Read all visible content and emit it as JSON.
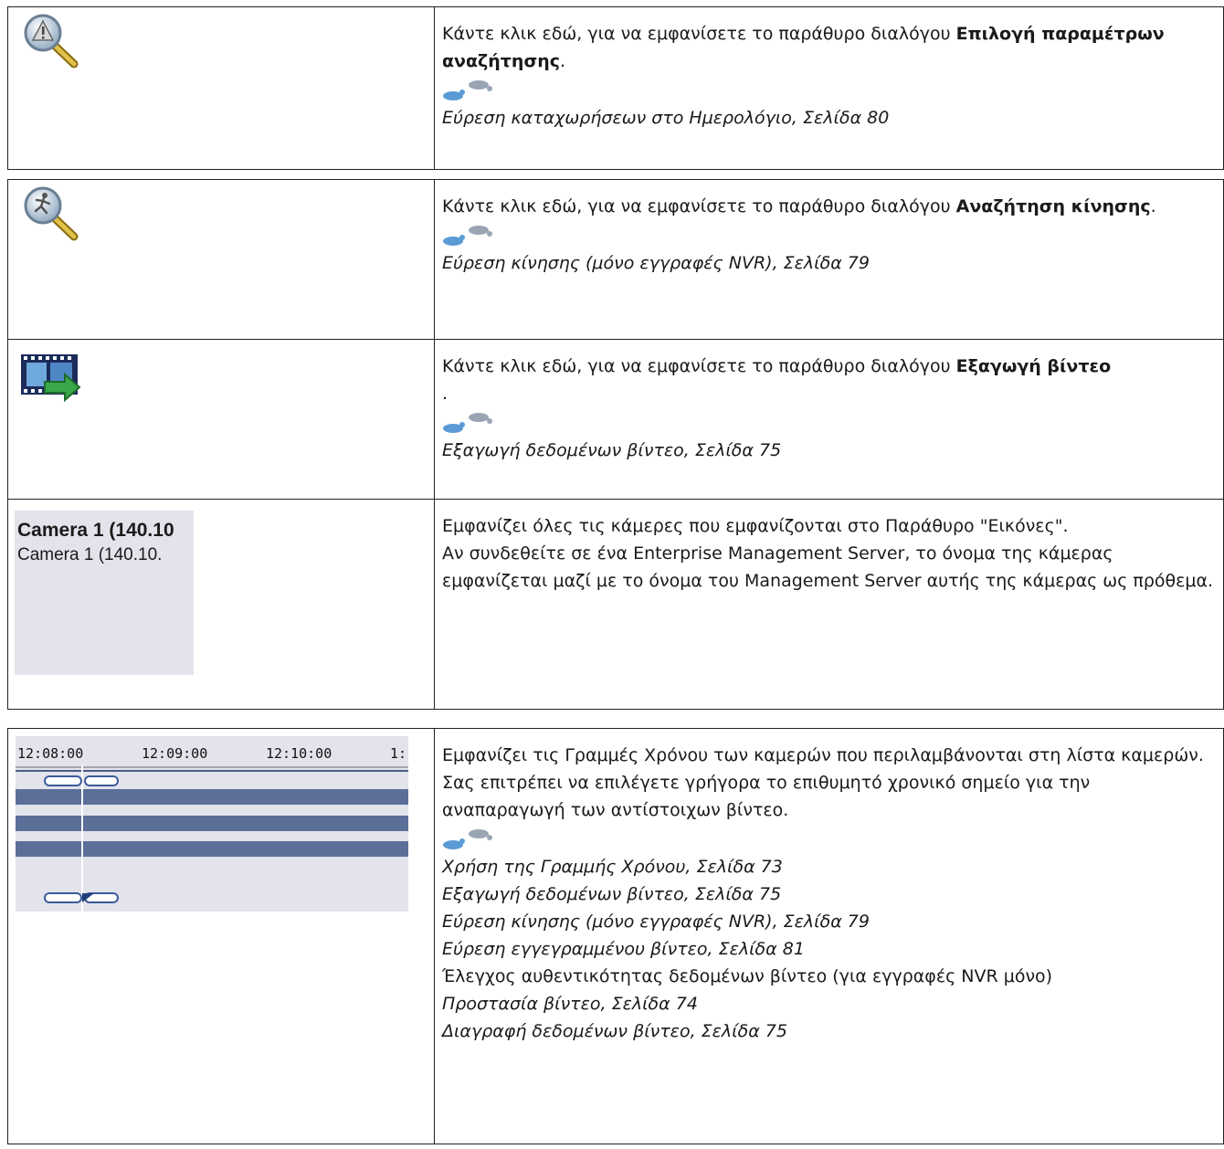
{
  "rows": [
    {
      "icon": "alarm-search-icon",
      "text_before": "Κάντε κλικ εδώ, για να εμφανίσετε το παράθυρο διαλόγου ",
      "bold": "Επιλογή παραμέτρων αναζήτησης",
      "text_after": ".",
      "links": [
        "Εύρεση καταχωρήσεων στο Ημερολόγιο, Σελίδα 80"
      ]
    },
    {
      "icon": "motion-search-icon",
      "text_before": "Κάντε κλικ εδώ, για να εμφανίσετε το παράθυρο διαλόγου ",
      "bold": "Αναζήτηση κίνησης",
      "text_after": ".",
      "links": [
        "Εύρεση κίνησης (μόνο εγγραφές NVR), Σελίδα 79"
      ]
    },
    {
      "icon": "video-export-icon",
      "text_before": "Κάντε κλικ εδώ, για να εμφανίσετε το παράθυρο διαλόγου ",
      "bold": "Εξαγωγή βίντεο",
      "text_after": ".",
      "links": [
        "Εξαγωγή δεδομένων βίντεο, Σελίδα 75"
      ]
    },
    {
      "icon": "camera-list",
      "camera_bold": "Camera 1 (140.10",
      "camera_normal": "Camera 1 (140.10.",
      "lines": [
        "Εμφανίζει όλες τις κάμερες που εμφανίζονται στο Παράθυρο \"Εικόνες\".",
        "Αν συνδεθείτε σε ένα Enterprise Management Server, το όνομα της κάμερας εμφανίζεται μαζί με το όνομα του Management Server αυτής της κάμερας ως πρόθεμα."
      ]
    },
    {
      "icon": "timeline",
      "timeline_ticks": [
        "12:08:00",
        "12:09:00",
        "12:10:00",
        "1:"
      ],
      "lines": [
        "Εμφανίζει τις Γραμμές Χρόνου των καμερών που περιλαμβάνονται στη λίστα καμερών.",
        "Σας επιτρέπει να επιλέγετε γρήγορα το επιθυμητό χρονικό σημείο για την αναπαραγωγή των αντίστοιχων βίντεο."
      ],
      "links": [
        "Χρήση της Γραμμής Χρόνου, Σελίδα 73",
        "Εξαγωγή δεδομένων βίντεο, Σελίδα 75",
        "Εύρεση κίνησης (μόνο εγγραφές NVR), Σελίδα 79",
        "Εύρεση εγγεγραμμένου βίντεο, Σελίδα 81"
      ],
      "plain_after": "Έλεγχος αυθεντικότητας δεδομένων βίντεο (για εγγραφές NVR μόνο)",
      "links_after": [
        "Προστασία βίντεο, Σελίδα 74",
        "Διαγραφή δεδομένων βίντεο, Σελίδα 75"
      ]
    }
  ]
}
